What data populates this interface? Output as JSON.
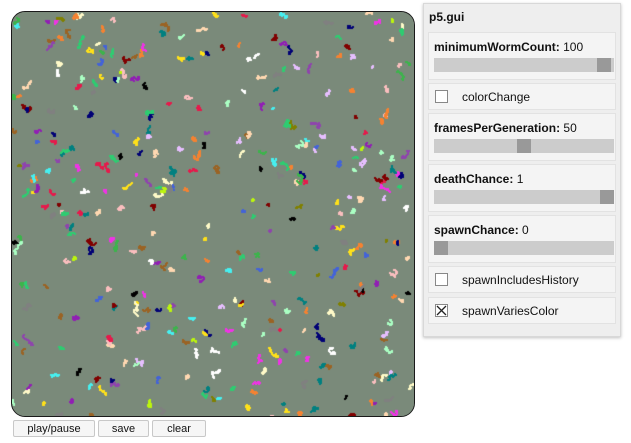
{
  "gui": {
    "title": "p5.gui",
    "sliders": [
      {
        "name": "minimumWormCount",
        "value": "100",
        "fraction": 0.98
      },
      {
        "name": "framesPerGeneration",
        "value": "50",
        "fraction": 0.5
      },
      {
        "name": "deathChance",
        "value": "1",
        "fraction": 1.0
      },
      {
        "name": "spawnChance",
        "value": "0",
        "fraction": 0.0
      }
    ],
    "checkboxes": [
      {
        "name": "colorChange",
        "checked": false
      },
      {
        "name": "spawnIncludesHistory",
        "checked": false
      },
      {
        "name": "spawnVariesColor",
        "checked": true
      }
    ]
  },
  "buttons": {
    "play_pause": "play/pause",
    "save": "save",
    "clear": "clear"
  },
  "palette": [
    "#e6194b",
    "#3cb44b",
    "#4363d8",
    "#f58231",
    "#911eb4",
    "#46f0f0",
    "#f032e6",
    "#bcf60c",
    "#fabebe",
    "#008080",
    "#e6beff",
    "#9a6324",
    "#fffac8",
    "#800000",
    "#aaffc3",
    "#808000",
    "#ffd8b1",
    "#000075",
    "#808080",
    "#ffe119",
    "#ffffff",
    "#000000",
    "#2ecc71",
    "#8e44ad"
  ]
}
